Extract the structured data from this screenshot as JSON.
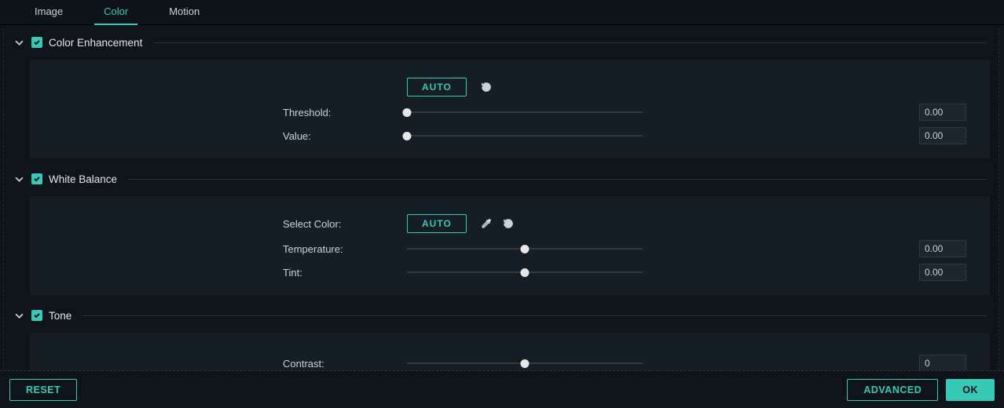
{
  "tabs": {
    "image": "Image",
    "color": "Color",
    "motion": "Motion",
    "active": "color"
  },
  "sections": {
    "colorEnhancement": {
      "title": "Color Enhancement",
      "checked": true,
      "autoLabel": "AUTO",
      "threshold": {
        "label": "Threshold:",
        "value": "0.00",
        "pos": 0
      },
      "value": {
        "label": "Value:",
        "value": "0.00",
        "pos": 0
      }
    },
    "whiteBalance": {
      "title": "White Balance",
      "checked": true,
      "selectColorLabel": "Select Color:",
      "autoLabel": "AUTO",
      "temperature": {
        "label": "Temperature:",
        "value": "0.00",
        "pos": 50
      },
      "tint": {
        "label": "Tint:",
        "value": "0.00",
        "pos": 50
      }
    },
    "tone": {
      "title": "Tone",
      "checked": true,
      "contrast": {
        "label": "Contrast:",
        "value": "0",
        "pos": 50
      }
    }
  },
  "footer": {
    "reset": "RESET",
    "advanced": "ADVANCED",
    "ok": "OK"
  }
}
